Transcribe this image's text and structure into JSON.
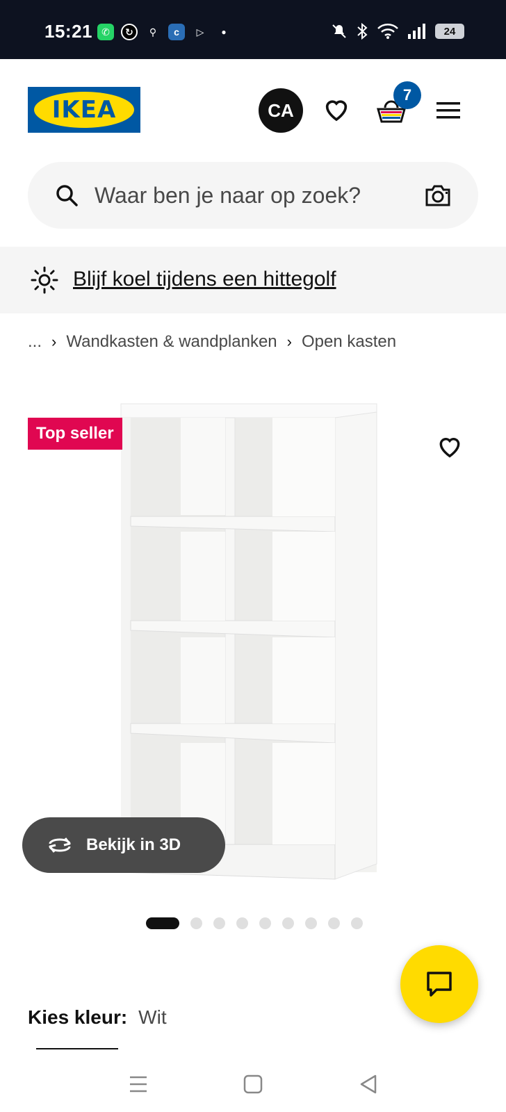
{
  "status_bar": {
    "time": "15:21",
    "battery": "24",
    "app_icons": [
      "whatsapp-icon",
      "sync-icon",
      "network-icon",
      "c-app-icon",
      "play-store-icon",
      "dot-icon"
    ],
    "right_icons": [
      "mute-icon",
      "bluetooth-icon",
      "wifi-icon",
      "signal-icon",
      "battery-icon"
    ]
  },
  "header": {
    "logo_text": "IKEA",
    "avatar_initials": "CA",
    "cart_count": "7"
  },
  "search": {
    "placeholder": "Waar ben je naar op zoek?"
  },
  "banner": {
    "link_text": "Blijf koel tijdens een hittegolf"
  },
  "breadcrumb": {
    "items": [
      "...",
      "Wandkasten & wandplanken",
      "Open kasten"
    ],
    "separator": "›"
  },
  "product": {
    "badge": "Top seller",
    "view_3d_label": "Bekijk in 3D",
    "image_count": 9,
    "active_image": 1
  },
  "color_choice": {
    "label": "Kies kleur:",
    "value": "Wit"
  },
  "colors": {
    "ikea_blue": "#0058a3",
    "ikea_yellow": "#ffdb00",
    "top_seller_red": "#e00751"
  }
}
